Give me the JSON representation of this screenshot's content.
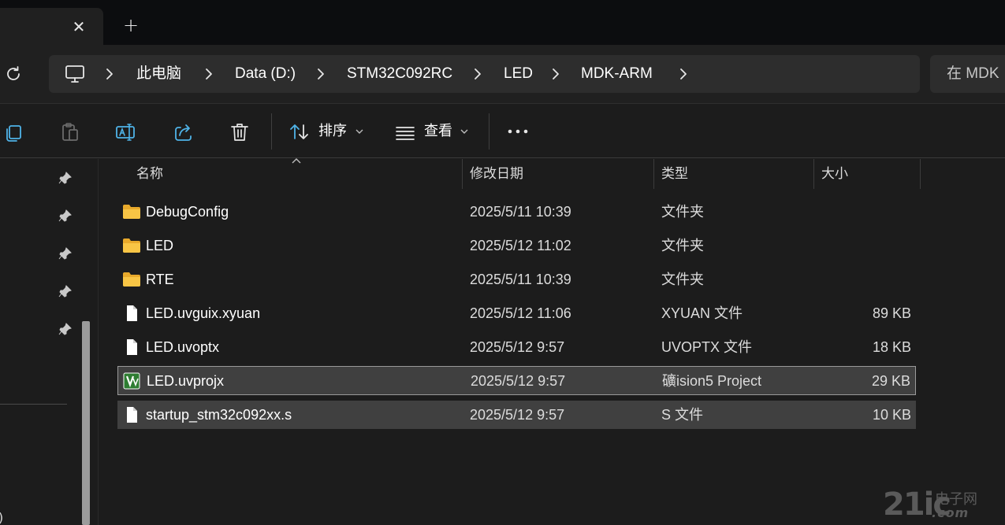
{
  "tab": {
    "close_glyph": "✕",
    "new_tab_glyph": "+"
  },
  "address": {
    "crumbs": [
      "此电脑",
      "Data (D:)",
      "STM32C092RC",
      "LED",
      "MDK-ARM"
    ],
    "search_placeholder": "在 MDK"
  },
  "toolbar": {
    "sort_label": "排序",
    "view_label": "查看",
    "icons": [
      "copy-icon",
      "paste-icon",
      "rename-icon",
      "share-icon",
      "delete-icon",
      "sort-icon",
      "view-icon",
      "more-icon"
    ]
  },
  "columns": {
    "name": "名称",
    "date": "修改日期",
    "type": "类型",
    "size": "大小"
  },
  "files": [
    {
      "name": "DebugConfig",
      "date": "2025/5/11 10:39",
      "type": "文件夹",
      "size": "",
      "icon": "folder-icon"
    },
    {
      "name": "LED",
      "date": "2025/5/12 11:02",
      "type": "文件夹",
      "size": "",
      "icon": "folder-icon"
    },
    {
      "name": "RTE",
      "date": "2025/5/11 10:39",
      "type": "文件夹",
      "size": "",
      "icon": "folder-icon"
    },
    {
      "name": "LED.uvguix.xyuan",
      "date": "2025/5/12 11:06",
      "type": "XYUAN 文件",
      "size": "89 KB",
      "icon": "file-icon"
    },
    {
      "name": "LED.uvoptx",
      "date": "2025/5/12 9:57",
      "type": "UVOPTX 文件",
      "size": "18 KB",
      "icon": "file-icon"
    },
    {
      "name": "LED.uvprojx",
      "date": "2025/5/12 9:57",
      "type": "礦ision5 Project",
      "size": "29 KB",
      "icon": "uvision-icon"
    },
    {
      "name": "startup_stm32c092xx.s",
      "date": "2025/5/12 9:57",
      "type": "S 文件",
      "size": "10 KB",
      "icon": "file-icon"
    }
  ],
  "nav": {
    "paren": ")"
  },
  "watermark": {
    "text": "21ic",
    "cn": "电子网",
    "com": ".com"
  },
  "colors": {
    "background": "#1c1c1c",
    "selected_row": "#404040",
    "folder": "#f8c545"
  }
}
